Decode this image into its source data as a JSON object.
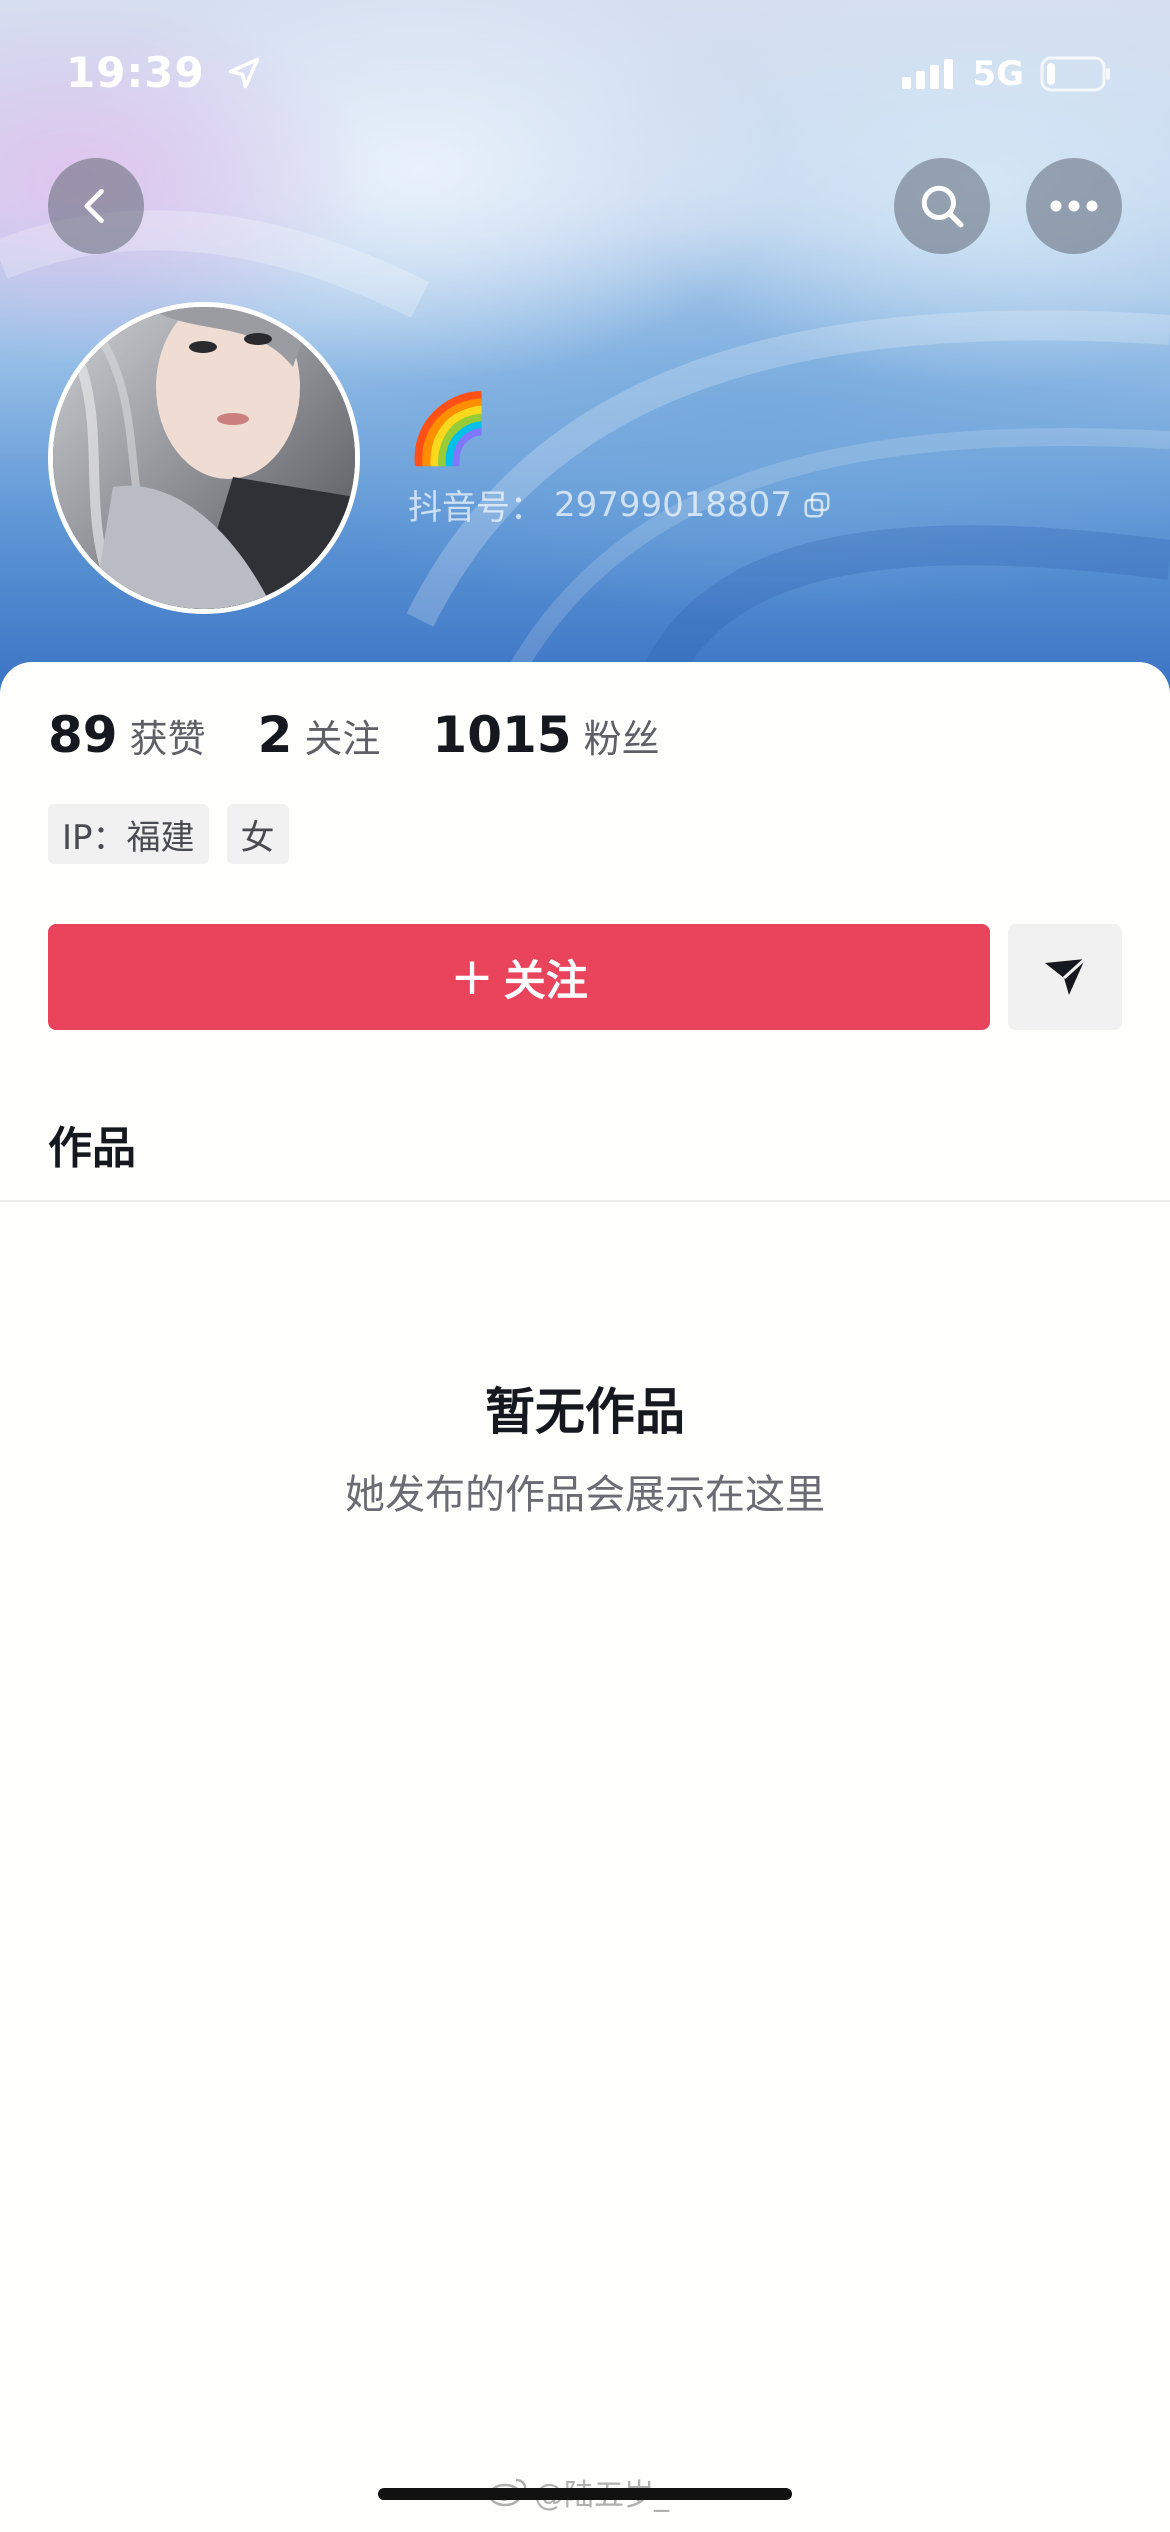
{
  "status_bar": {
    "time": "19:39",
    "network": "5G",
    "battery_level": 0.15
  },
  "header": {
    "back_icon": "chevron-left-icon",
    "search_icon": "search-icon",
    "more_icon": "more-horizontal-icon"
  },
  "profile": {
    "nickname": "🌈",
    "douyin_id_label": "抖音号：",
    "douyin_id": "29799018807",
    "copy_icon": "copy-icon"
  },
  "stats": [
    {
      "value": "89",
      "label": "获赞"
    },
    {
      "value": "2",
      "label": "关注"
    },
    {
      "value": "1015",
      "label": "粉丝"
    }
  ],
  "tags": [
    "IP：福建",
    "女"
  ],
  "actions": {
    "follow_plus": "+",
    "follow_label": "关注",
    "share_icon": "send-icon"
  },
  "tabs": {
    "works": "作品"
  },
  "empty_state": {
    "title": "暂无作品",
    "subtitle": "她发布的作品会展示在这里"
  },
  "watermark": {
    "text": "@陆五岁_",
    "icon": "weibo-icon"
  },
  "colors": {
    "follow_button": "#ea445c",
    "header_blue": "#3a72c4"
  }
}
